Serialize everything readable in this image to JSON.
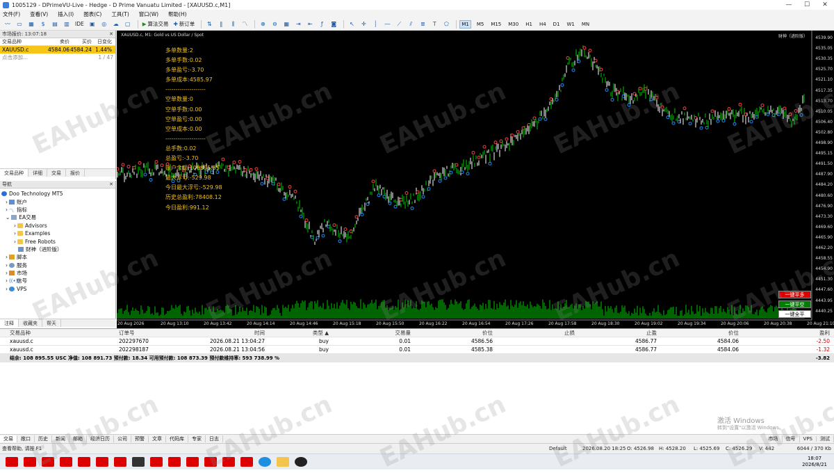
{
  "window": {
    "title": "1005129 - DPrimeVU-Live - Hedge - D Prime Vanuatu Limited - [XAUUSD.c,M1]"
  },
  "menu": [
    "文件(F)",
    "查看(V)",
    "插入(I)",
    "图表(C)",
    "工具(T)",
    "窗口(W)",
    "帮助(H)"
  ],
  "toolbar": {
    "ide": "IDE",
    "algo_trading": "算法交易",
    "new_order": "新订单",
    "timeframes": [
      "M1",
      "M5",
      "M15",
      "M30",
      "H1",
      "H4",
      "D1",
      "W1",
      "MN"
    ],
    "active_tf": "M1"
  },
  "market_watch": {
    "title": "市场报价: 13:07:18",
    "headers": [
      "交易品种",
      "卖价",
      "买价",
      "日变化"
    ],
    "rows": [
      {
        "symbol": "XAUUSD.c",
        "bid": "4584.06",
        "ask": "4584.24",
        "change": "1.44%"
      }
    ],
    "add_label": "点击添加...",
    "count": "1 / 47",
    "tabs": [
      "交易品种",
      "详细",
      "交易",
      "报价"
    ]
  },
  "navigator": {
    "title": "导航",
    "items": [
      "Doo Technology MT5",
      "账户",
      "指标",
      "EA交易",
      "Advisors",
      "Examples",
      "Free Robots",
      "财神（进阶版）",
      "脚本",
      "服务",
      "市场",
      "信号",
      "VPS"
    ],
    "tabs": [
      "注释",
      "收藏夹",
      "帮天"
    ]
  },
  "chart": {
    "title": "XAUUSD.c, M1:  Gold vs US Dollar / Spot",
    "ea_label": "财神（进阶版）",
    "info": [
      "多单数量:2",
      "多单手数:0.02",
      "多单盈亏:-3.70",
      "多单成本:4585.97",
      "--------------------",
      "空单数量:0",
      "空单手数:0.00",
      "空单盈亏:0.00",
      "空单成本:0.00",
      "--------------------",
      "总手数:0.02",
      "总盈亏:-3.70",
      "账户余额:108895.55",
      "最大浮亏:-529.98",
      "今日最大浮亏:-529.98",
      "历史总盈利:78408.12",
      "今日盈利:991.12"
    ],
    "price_labels": [
      "4539.90",
      "4535.05",
      "4530.35",
      "4525.70",
      "4521.10",
      "4517.35",
      "4513.70",
      "4510.05",
      "4506.40",
      "4502.80",
      "4498.90",
      "4495.15",
      "4491.50",
      "4487.90",
      "4484.20",
      "4480.60",
      "4476.90",
      "4473.30",
      "4469.60",
      "4465.90",
      "4462.20",
      "4458.55",
      "4454.90",
      "4451.30",
      "4447.60",
      "4443.95",
      "4440.25"
    ],
    "time_labels": [
      "20 Aug 2026",
      "20 Aug 13:10",
      "20 Aug 13:42",
      "20 Aug 14:14",
      "20 Aug 14:46",
      "20 Aug 15:18",
      "20 Aug 15:50",
      "20 Aug 16:22",
      "20 Aug 16:54",
      "20 Aug 17:26",
      "20 Aug 17:58",
      "20 Aug 18:30",
      "20 Aug 19:02",
      "20 Aug 19:34",
      "20 Aug 20:06",
      "20 Aug 20:38",
      "20 Aug 21:10"
    ],
    "buttons": {
      "close_buy": "一键平多",
      "close_sell": "一键平空",
      "close_all": "一键全平"
    },
    "colors": {
      "up": "#00c800",
      "down": "#ffffff",
      "buy_marker": "#1e90ff",
      "sell_marker": "#ff4040",
      "info": "#f0c020"
    }
  },
  "trade": {
    "headers": [
      "交易品种",
      "订单号",
      "时间",
      "类型 ▲",
      "交易量",
      "价位",
      "止损",
      "止盈",
      "价位",
      "盈利"
    ],
    "rows": [
      {
        "symbol": "xauusd.c",
        "ticket": "202297670",
        "time": "2026.08.21 13:04:27",
        "type": "buy",
        "volume": "0.01",
        "price": "4586.56",
        "sl": "",
        "tp": "4586.77",
        "current": "4584.06",
        "profit": "-2.50"
      },
      {
        "symbol": "xauusd.c",
        "ticket": "202298187",
        "time": "2026.08.21 13:04:56",
        "type": "buy",
        "volume": "0.01",
        "price": "4585.38",
        "sl": "",
        "tp": "4586.77",
        "current": "4584.06",
        "profit": "-1.32"
      }
    ],
    "summary": "结余: 108 895.55 USC  净值: 108 891.73  预付款: 18.34  可用预付款: 108 873.39  预付款维持率: 593 738.99 %",
    "summary_profit": "-3.82"
  },
  "bottom_tabs": [
    "交易",
    "敞口",
    "历史",
    "新闻",
    "邮箱",
    "经济日历",
    "公司",
    "预警",
    "文章",
    "代码库",
    "专家",
    "日志"
  ],
  "bottom_right": [
    "市场",
    "信号",
    "VPS",
    "测试"
  ],
  "status": {
    "help": "查看帮助, 请按 F1",
    "profile": "Default",
    "time": "2026.08.20 18:25",
    "open": "O: 4526.98",
    "high": "H: 4528.20",
    "low": "L: 4525.69",
    "close": "C: 4526.29",
    "volume": "V: 442",
    "traffic": "6044 / 370 Kb"
  },
  "taskbar": {
    "time": "18:07",
    "date": "2026/8/21"
  },
  "os_watermark": {
    "line1": "激活 Windows",
    "line2": "转到\"设置\"以激活 Windows。"
  },
  "watermark": "EAHub.cn"
}
